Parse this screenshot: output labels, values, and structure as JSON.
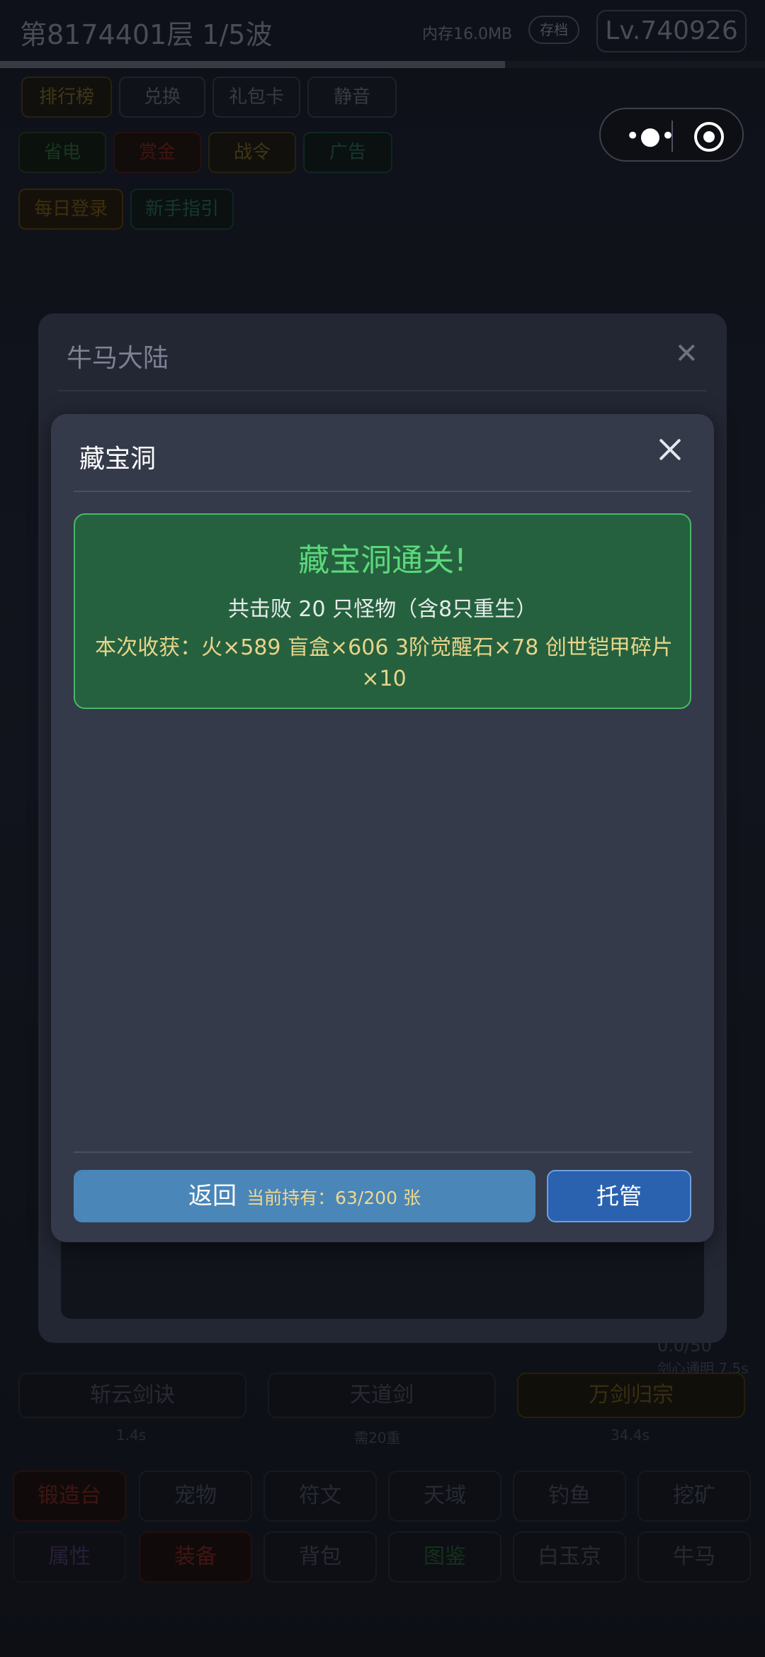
{
  "background": {
    "floor_wave": "第8174401层  1/5波",
    "memory": "内存16.0MB",
    "save_label": "存档",
    "level": "Lv.740926",
    "progress_fraction": 0.66,
    "row1": [
      "排行榜",
      "兑换",
      "礼包卡",
      "静音"
    ],
    "row2": [
      "省电",
      "赏金",
      "战令",
      "广告"
    ],
    "row3": [
      "每日登录",
      "新手指引"
    ],
    "right_stat": "0.0/50",
    "right_stat2": "剑心通明 7.5s",
    "skills": [
      "斩云剑诀",
      "天道剑",
      "万剑归宗"
    ],
    "skill_times": [
      "1.4s",
      "需20重",
      "34.4s"
    ],
    "nav_row1": [
      "锻造台",
      "宠物",
      "符文",
      "天域",
      "钓鱼",
      "挖矿"
    ],
    "nav_row2": [
      "属性",
      "装备",
      "背包",
      "图鉴",
      "白玉京",
      "牛马"
    ]
  },
  "capsule": {
    "menu_icon": "more-dots-icon",
    "close_icon": "target-circle-icon"
  },
  "outer_modal": {
    "title": "牛马大陆",
    "close_glyph": "✕"
  },
  "modal": {
    "title": "藏宝洞",
    "result": {
      "headline": "藏宝洞通关!",
      "summary": "共击败 20 只怪物（含8只重生）",
      "loot": "本次收获：火×589  盲盒×606  3阶觉醒石×78  创世铠甲碎片×10"
    },
    "return_label": "返回",
    "holding_text": "当前持有：63/200 张",
    "auto_label": "托管"
  },
  "colors": {
    "result_bg": "#25613e",
    "result_border": "#48b868",
    "headline": "#5cd87c",
    "loot": "#e8d48a",
    "return_btn": "#4a86b8",
    "auto_btn": "#2a62b0"
  }
}
